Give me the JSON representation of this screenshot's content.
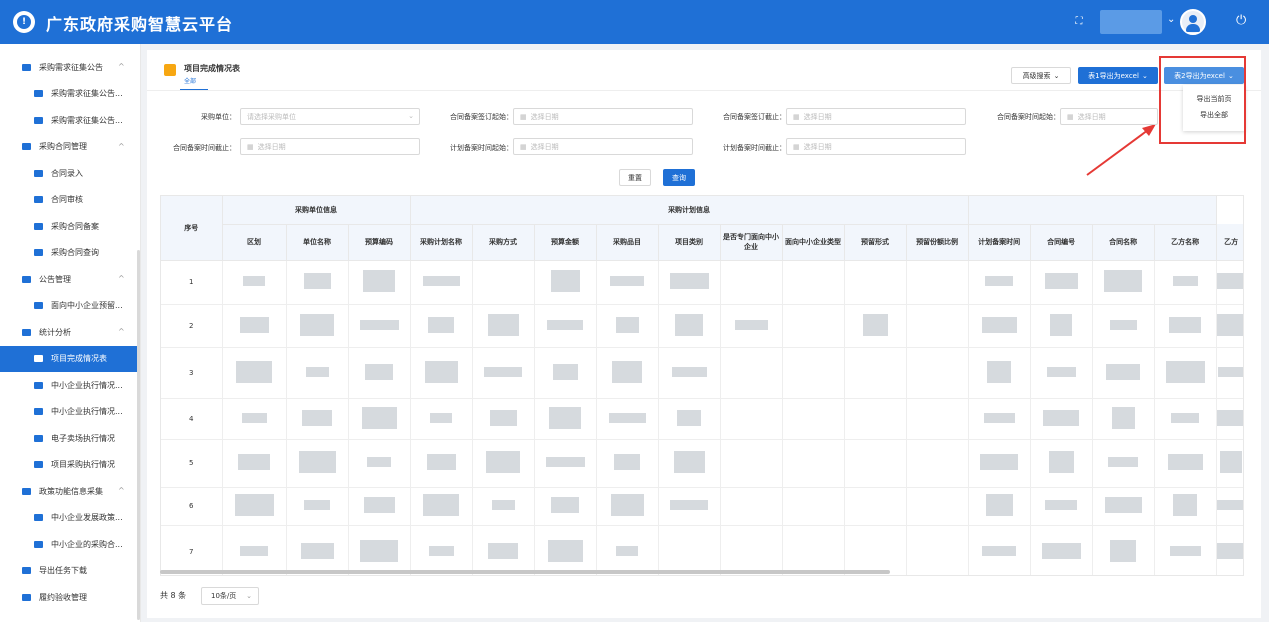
{
  "header": {
    "app_title": "广东政府采购智慧云平台"
  },
  "sidebar": {
    "items": [
      {
        "label": "采购需求征集公告",
        "level": 1,
        "arrow": "^"
      },
      {
        "label": "采购需求征集公告...",
        "level": 2
      },
      {
        "label": "采购需求征集公告...",
        "level": 2
      },
      {
        "label": "采购合同管理",
        "level": 1,
        "arrow": "^"
      },
      {
        "label": "合同录入",
        "level": 2
      },
      {
        "label": "合同审核",
        "level": 2
      },
      {
        "label": "采购合同备案",
        "level": 2
      },
      {
        "label": "采购合同查询",
        "level": 2
      },
      {
        "label": "公告管理",
        "level": 1,
        "arrow": "^"
      },
      {
        "label": "面向中小企业预留...",
        "level": 2
      },
      {
        "label": "统计分析",
        "level": 1,
        "arrow": "^"
      },
      {
        "label": "项目完成情况表",
        "level": 2,
        "active": true
      },
      {
        "label": "中小企业执行情况...",
        "level": 2
      },
      {
        "label": "中小企业执行情况...",
        "level": 2
      },
      {
        "label": "电子卖场执行情况",
        "level": 2
      },
      {
        "label": "项目采购执行情况",
        "level": 2
      },
      {
        "label": "政策功能信息采集",
        "level": 1,
        "arrow": "^"
      },
      {
        "label": "中小企业发展政策...",
        "level": 2
      },
      {
        "label": "中小企业的采购合...",
        "level": 2
      },
      {
        "label": "导出任务下载",
        "level": 1
      },
      {
        "label": "履约验收管理",
        "level": 1
      }
    ]
  },
  "page": {
    "title": "项目完成情况表",
    "subtitle": "全部"
  },
  "toolbar": {
    "advanced_search": "高级搜索",
    "export_table1": "表1导出为excel",
    "export_table2": "表2导出为excel",
    "export_menu": [
      "导出当前页",
      "导出全部"
    ]
  },
  "filters": {
    "purchase_unit_label": "采购单位：",
    "purchase_unit_placeholder": "请选择采购单位",
    "date_placeholder": "选择日期",
    "contract_sign_start_label": "合同备案签订起始：",
    "contract_sign_end_label": "合同备案签订截止：",
    "contract_record_start_label": "合同备案时间起始：",
    "contract_record_end_label": "合同备案时间截止：",
    "plan_record_start_label": "计划备案时间起始：",
    "plan_record_end_label": "计划备案时间截止：",
    "reset": "重置",
    "query": "查询"
  },
  "table": {
    "index_header": "序号",
    "group_headers": [
      "采购单位信息",
      "采购计划信息"
    ],
    "columns": [
      "区划",
      "单位名称",
      "预算编码",
      "采购计划名称",
      "采购方式",
      "预算金额",
      "采购品目",
      "项目类别",
      "是否专门面向中小企业",
      "面向中小企业类型",
      "预留形式",
      "预留份额比例",
      "计划备案时间",
      "合同编号",
      "合同名称",
      "乙方名称",
      "乙方"
    ],
    "rows": [
      "1",
      "2",
      "3",
      "4",
      "5",
      "6",
      "7"
    ]
  },
  "pagination": {
    "total": "共 8 条",
    "page_size": "10条/页"
  },
  "colors": {
    "primary": "#1f70d6",
    "highlight": "#e53935",
    "page_icon": "#f7a712"
  }
}
